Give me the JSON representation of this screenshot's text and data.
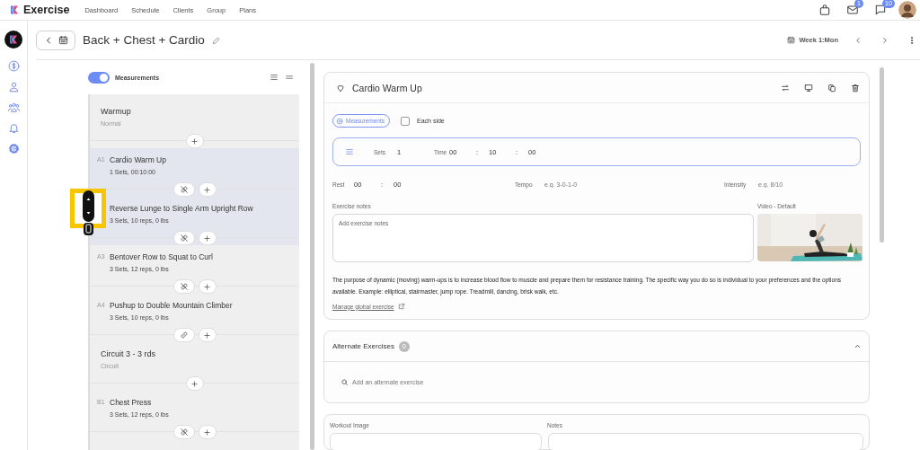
{
  "app": {
    "name": "Exercise"
  },
  "nav": [
    "Dashboard",
    "Schedule",
    "Clients",
    "Group",
    "Plans"
  ],
  "top_actions": [
    {
      "kind": "bag"
    },
    {
      "kind": "mail",
      "badge": "1"
    },
    {
      "kind": "chat",
      "badge": "10"
    },
    {
      "kind": "avatar"
    }
  ],
  "rail": [
    {
      "kind": "dollar"
    },
    {
      "kind": "user"
    },
    {
      "kind": "group"
    },
    {
      "kind": "bell"
    },
    {
      "kind": "gear"
    }
  ],
  "header": {
    "title": "Back + Chest + Cardio",
    "week": "Week 1:Mon"
  },
  "list": {
    "toggle": {
      "label": "Measurements",
      "on": true
    },
    "items": [
      {
        "kind": "group",
        "title": "Warmup",
        "subtitle": "Normal",
        "selected": false
      },
      {
        "kind": "exercise",
        "label": "A1",
        "title": "Cardio Warm Up",
        "subtitle": "1 Sets, 00:10:00",
        "selected": true,
        "linked": false
      },
      {
        "kind": "exercise",
        "title": "Reverse Lunge to Single Arm Upright Row",
        "subtitle": "3 Sets, 10 reps, 0 lbs",
        "selected": true,
        "linked": false
      },
      {
        "kind": "exercise",
        "label": "A3",
        "title": "Bentover Row to Squat to Curl",
        "subtitle": "3 Sets, 12 reps, 0 lbs",
        "selected": false,
        "linked": false
      },
      {
        "kind": "exercise",
        "label": "A4",
        "title": "Pushup to Double Mountain Climber",
        "subtitle": "3 Sets, 10 reps, 0 lbs",
        "selected": false,
        "linked": true
      },
      {
        "kind": "group",
        "title": "Circuit 3 - 3 rds",
        "subtitle": "Circuit",
        "selected": false
      },
      {
        "kind": "exercise",
        "label": "B1",
        "title": "Chest Press",
        "subtitle": "3 Sets, 12 reps, 0 lbs",
        "selected": false,
        "linked": false
      }
    ]
  },
  "detail": {
    "name": "Cardio Warm Up",
    "favorite": false,
    "measurements_button": "Measurements",
    "each_side": {
      "label": "Each side",
      "checked": false
    },
    "sets_label": "Sets",
    "sets": "1",
    "time_label": "Time",
    "time": [
      "00",
      "10",
      "00"
    ],
    "separator": ":",
    "rest_label": "Rest",
    "rest": [
      "00",
      "00"
    ],
    "tempo_label": "Tempo",
    "tempo_placeholder": "e.g. 3-0-1-0",
    "intensity_label": "Intensity",
    "intensity_placeholder": "e.g. 8/10",
    "notes_label": "Exercise notes",
    "notes_placeholder": "Add exercise notes",
    "video_label": "Video - Default",
    "video": {
      "kind": "picture"
    },
    "description": "The purpose of dynamic (moving) warm-ups is to increase blood flow to muscle and prepare them for resistance training. The specific way you do so is individual to your preferences and the options available. Example: elliptical, stairmaster, jump rope. Treadmill, dancing, brisk walk, etc.",
    "manage_link": "Manage global exercise"
  },
  "alternates": {
    "title": "Alternate Exercises",
    "count": "0",
    "expanded": true,
    "search_placeholder": "Add an alternate exercise"
  },
  "workout": {
    "image_label": "Workout Image",
    "notes_label": "Notes"
  }
}
